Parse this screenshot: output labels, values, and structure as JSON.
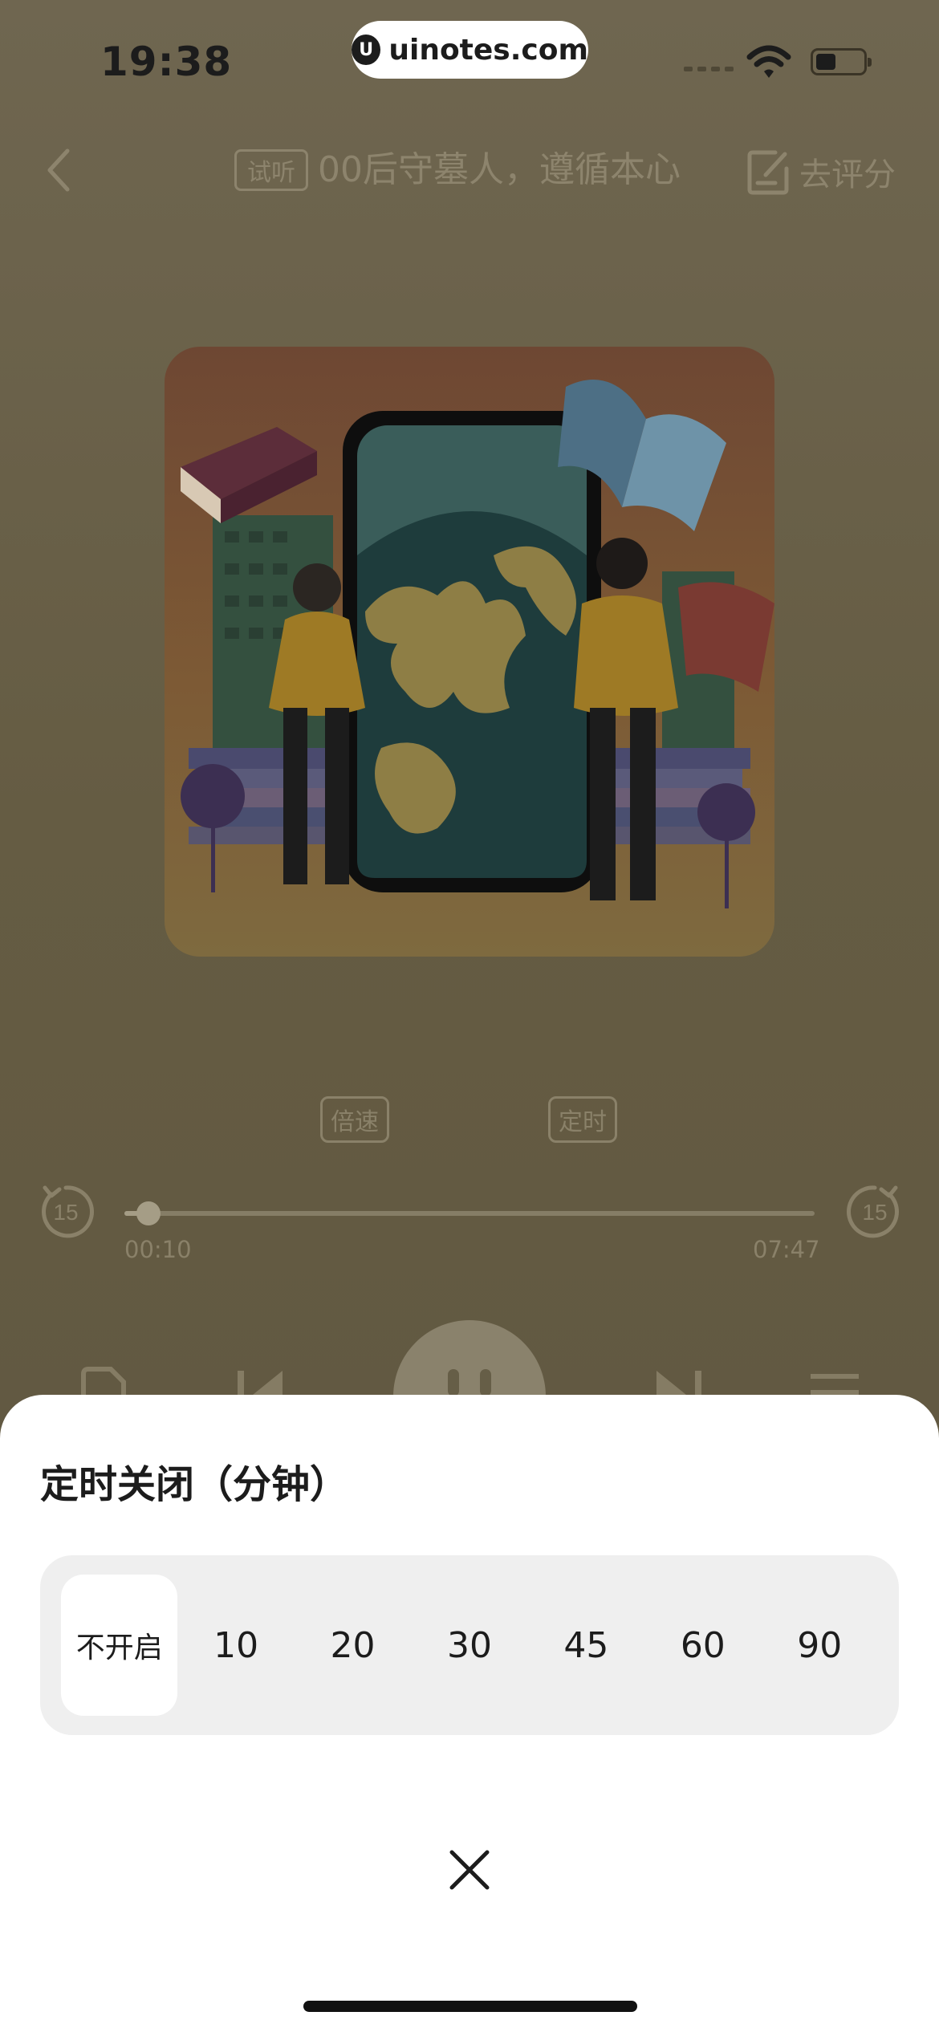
{
  "status_bar": {
    "time": "19:38"
  },
  "watermark": {
    "logo_letter": "U",
    "text": "uinotes.com"
  },
  "nav": {
    "back_icon": "chevron-left-icon",
    "trial_badge": "试听",
    "title": "00后守墓人，遵循本心",
    "rate_label": "去评分",
    "rate_icon": "edit-icon"
  },
  "player": {
    "speed_label": "倍速",
    "timer_label": "定时",
    "skip_back_seconds": "15",
    "skip_forward_seconds": "15",
    "current_time": "00:10",
    "total_time": "07:47",
    "progress_fraction": 0.035
  },
  "timer_sheet": {
    "title": "定时关闭（分钟）",
    "options": [
      "不开启",
      "10",
      "20",
      "30",
      "45",
      "60",
      "90"
    ],
    "selected": "不开启",
    "close_icon": "close-icon"
  },
  "colors": {
    "overlay_background": "#6a6146",
    "sheet_background": "#ffffff",
    "option_track": "#efefef"
  }
}
